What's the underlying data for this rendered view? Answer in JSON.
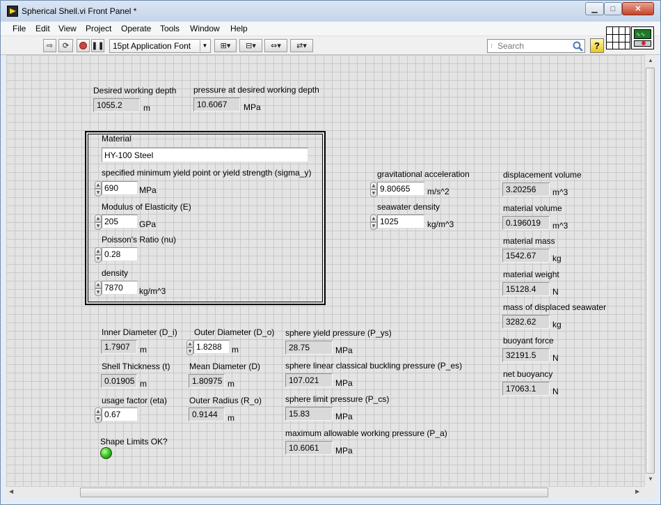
{
  "window": {
    "title": "Spherical Shell.vi Front Panel *",
    "min_label": "▁",
    "max_label": "□",
    "close_label": "✕"
  },
  "menu": [
    "File",
    "Edit",
    "View",
    "Project",
    "Operate",
    "Tools",
    "Window",
    "Help"
  ],
  "toolbar": {
    "font": "15pt Application Font",
    "search_placeholder": "Search",
    "help_label": "?"
  },
  "panel": {
    "depth": {
      "label": "Desired working depth",
      "value": "1055.2",
      "unit": "m"
    },
    "pressure_depth": {
      "label": "pressure at desired working depth",
      "value": "10.6067",
      "unit": "MPa"
    },
    "material": {
      "label": "Material",
      "value": "HY-100 Steel",
      "yield": {
        "label": "specified minimum yield point or yield strength (sigma_y)",
        "value": "690",
        "unit": "MPa"
      },
      "modulus": {
        "label": "Modulus of Elasticity (E)",
        "value": "205",
        "unit": "GPa"
      },
      "poisson": {
        "label": "Poisson's Ratio (nu)",
        "value": "0.28"
      },
      "density": {
        "label": "density",
        "value": "7870",
        "unit": "kg/m^3"
      }
    },
    "gravity": {
      "label": "gravitational acceleration",
      "value": "9.80665",
      "unit": "m/s^2"
    },
    "seawater_density": {
      "label": "seawater density",
      "value": "1025",
      "unit": "kg/m^3"
    },
    "displacement_volume": {
      "label": "displacement volume",
      "value": "3.20256",
      "unit": "m^3"
    },
    "material_volume": {
      "label": "material volume",
      "value": "0.196019",
      "unit": "m^3"
    },
    "material_mass": {
      "label": "material mass",
      "value": "1542.67",
      "unit": "kg"
    },
    "material_weight": {
      "label": "material weight",
      "value": "15128.4",
      "unit": "N"
    },
    "displaced_mass": {
      "label": "mass of displaced seawater",
      "value": "3282.62",
      "unit": "kg"
    },
    "buoyant_force": {
      "label": "buoyant force",
      "value": "32191.5",
      "unit": "N"
    },
    "net_buoyancy": {
      "label": "net buoyancy",
      "value": "17063.1",
      "unit": "N"
    },
    "inner_diameter": {
      "label": "Inner Diameter (D_i)",
      "value": "1.7907",
      "unit": "m"
    },
    "outer_diameter": {
      "label": "Outer Diameter (D_o)",
      "value": "1.8288",
      "unit": "m"
    },
    "shell_thickness": {
      "label": "Shell Thickness (t)",
      "value": "0.01905",
      "unit": "m"
    },
    "mean_diameter": {
      "label": "Mean Diameter (D)",
      "value": "1.80975",
      "unit": "m"
    },
    "usage_factor": {
      "label": "usage factor (eta)",
      "value": "0.67"
    },
    "outer_radius": {
      "label": "Outer Radius (R_o)",
      "value": "0.9144",
      "unit": "m"
    },
    "shape_limits": {
      "label": "Shape Limits OK?",
      "state": "on"
    },
    "p_ys": {
      "label": "sphere yield pressure (P_ys)",
      "value": "28.75",
      "unit": "MPa"
    },
    "p_es": {
      "label": "sphere linear classical buckling pressure (P_es)",
      "value": "107.021",
      "unit": "MPa"
    },
    "p_cs": {
      "label": "sphere limit pressure (P_cs)",
      "value": "15.83",
      "unit": "MPa"
    },
    "p_a": {
      "label": "maximum allowable working pressure (P_a)",
      "value": "10.6061",
      "unit": "MPa"
    }
  },
  "colors": {
    "led_on": "#2fbf1c",
    "panel_bg": "#e4e4e4",
    "grid": "#c9c9c9"
  }
}
